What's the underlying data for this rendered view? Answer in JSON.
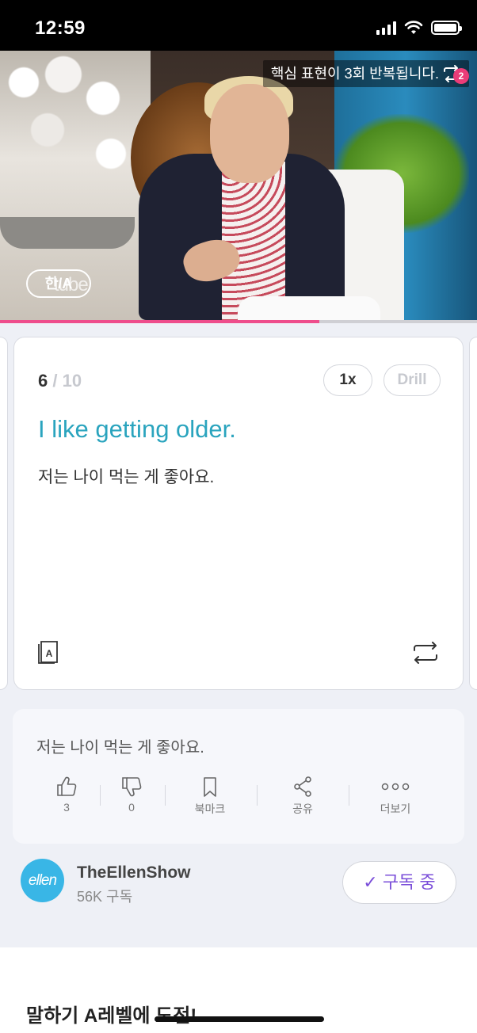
{
  "status_bar": {
    "time": "12:59"
  },
  "video": {
    "caption_banner": "핵심 표현이 3회 반복됩니다.",
    "repeat_count_badge": "2",
    "lang_toggle": "한/A",
    "watermark": "tube",
    "progress_fraction": 0.67
  },
  "card": {
    "current": "6",
    "total": " / 10",
    "speed_label": "1x",
    "drill_label": "Drill",
    "sentence_en": "I like getting older.",
    "sentence_ko": "저는 나이 먹는 게 좋아요."
  },
  "info": {
    "text": "저는 나이 먹는 게 좋아요.",
    "actions": [
      {
        "icon": "thumbs-up-icon",
        "label": "3"
      },
      {
        "icon": "thumbs-down-icon",
        "label": "0"
      },
      {
        "icon": "bookmark-icon",
        "label": "북마크"
      },
      {
        "icon": "share-icon",
        "label": "공유"
      },
      {
        "icon": "more-icon",
        "label": "더보기"
      }
    ]
  },
  "channel": {
    "avatar_text": "ellen",
    "name": "TheEllenShow",
    "subscribers": "56K 구독",
    "subscribe_label": "✓ 구독 중"
  },
  "bottom": {
    "title": "말하기 A레벨에 도전!"
  },
  "colors": {
    "accent_teal": "#2aa4be",
    "progress_pink": "#ee4d8c",
    "subscribe_purple": "#7b4fd9",
    "avatar_blue": "#39b6e6"
  }
}
